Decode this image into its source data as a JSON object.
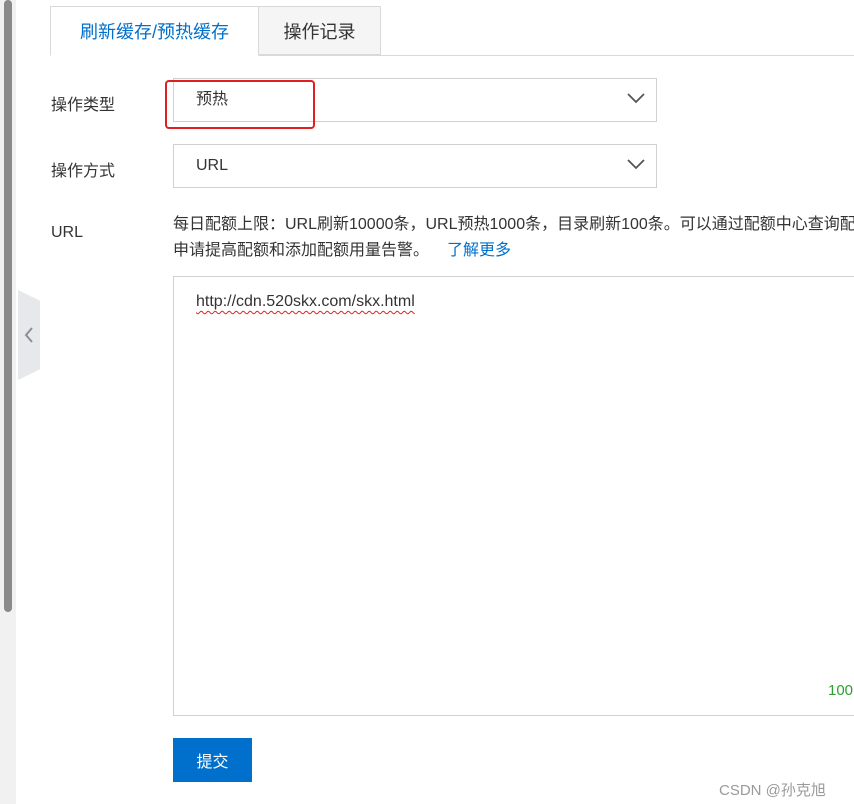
{
  "tabs": [
    {
      "label": "刷新缓存/预热缓存",
      "active": true
    },
    {
      "label": "操作记录",
      "active": false
    }
  ],
  "form": {
    "operation_type": {
      "label": "操作类型",
      "value": "预热"
    },
    "operation_mode": {
      "label": "操作方式",
      "value": "URL"
    },
    "url": {
      "label": "URL",
      "hint_line1": "每日配额上限：URL刷新10000条，URL预热1000条，目录刷新100条。可以通过配额中心查询配",
      "hint_line2": "申请提高配额和添加配额用量告警。",
      "learn_more": "了解更多",
      "textarea_value": "http://cdn.520skx.com/skx.html",
      "counter": "100"
    },
    "submit_label": "提交"
  },
  "watermark": "CSDN @孙克旭",
  "colors": {
    "accent": "#0070cc",
    "highlight_border": "#e02020",
    "counter": "#2ca02c"
  }
}
